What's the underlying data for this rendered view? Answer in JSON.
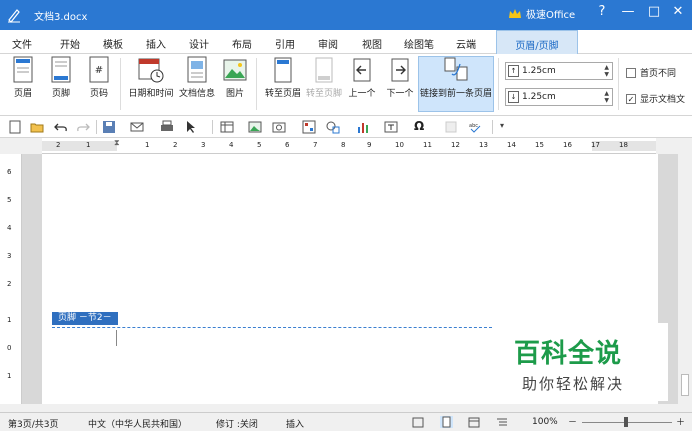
{
  "window": {
    "title": "文档3.docx",
    "brand": "极速Office",
    "help": "?",
    "minimize": "—",
    "maximize": "□",
    "close": "✕"
  },
  "menu": {
    "tabs": [
      "文件",
      "开始",
      "模板",
      "插入",
      "设计",
      "布局",
      "引用",
      "审阅",
      "视图",
      "绘图笔",
      "云端"
    ],
    "active": "页眉/页脚"
  },
  "ribbon": {
    "header": "页眉",
    "footer": "页脚",
    "page_number": "页码",
    "date_time": "日期和时间",
    "doc_info": "文档信息",
    "picture": "图片",
    "goto_header": "转至页眉",
    "goto_footer": "转至页脚",
    "prev": "上一个",
    "next": "下一个",
    "link_prev": "链接到前一条页眉",
    "header_distance": "1.25cm",
    "footer_distance": "1.25cm",
    "first_page_diff": "首页不同",
    "show_doc_text": "显示文档文"
  },
  "ruler": {
    "h_ticks": [
      "2",
      "1",
      "1",
      "2",
      "3",
      "4",
      "5",
      "6",
      "7",
      "8",
      "9",
      "10",
      "11",
      "12",
      "13",
      "14",
      "15",
      "16",
      "17",
      "18"
    ],
    "v_ticks": [
      "6",
      "5",
      "4",
      "3",
      "2",
      "1",
      "0",
      "1"
    ]
  },
  "document": {
    "footer_label": "页脚 －节2－"
  },
  "status": {
    "page": "第3页/共3页",
    "language": "中文（中华人民共和国）",
    "revision": "修订 :关闭",
    "mode": "插入",
    "zoom": "100%"
  },
  "watermark": {
    "main": "百科全说",
    "sub": "助你轻松解决"
  },
  "colors": {
    "title_bar": "#2b78d2",
    "active_tab": "#d7e7f7",
    "footer_tag": "#2f6fbf",
    "watermark_green": "#1d9b4a"
  }
}
